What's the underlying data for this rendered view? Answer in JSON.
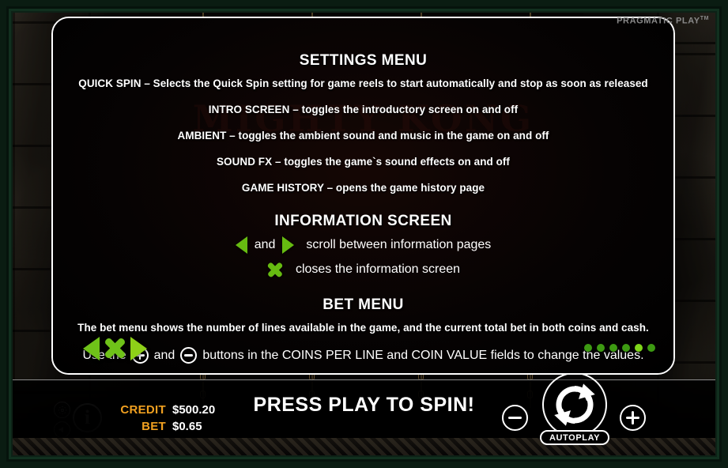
{
  "brand": {
    "name": "PRAGMATIC PLAY",
    "tm": "TM"
  },
  "background": {
    "game_logo": "MIGHTY KONG"
  },
  "panel": {
    "settings": {
      "title": "SETTINGS MENU",
      "lines": [
        "QUICK SPIN – Selects the Quick Spin setting for game reels to start automatically and stop as soon as released",
        "INTRO SCREEN – toggles the introductory screen on and off",
        "AMBIENT – toggles the ambient sound and music in the game on and off",
        "SOUND FX – toggles the game`s sound effects on and off",
        "GAME HISTORY – opens the game history page"
      ]
    },
    "information": {
      "title": "INFORMATION SCREEN",
      "scroll_and": "and",
      "scroll_text": "scroll between information pages",
      "close_text": "closes the information screen"
    },
    "bet": {
      "title": "BET MENU",
      "line1": "The bet menu shows the number of lines available in the game, and the current total bet in both coins and cash.",
      "line2_a": "Use the",
      "line2_and": "and",
      "line2_b": "buttons in the COINS PER LINE and COIN VALUE fields to change the values."
    },
    "nav": {
      "prev": "prev-page-arrow",
      "close": "close-info-screen",
      "next": "next-page-arrow"
    },
    "pagination": {
      "total": 6,
      "active_index": 4
    }
  },
  "hud": {
    "credit_label": "CREDIT",
    "credit_value": "$500.20",
    "bet_label": "BET",
    "bet_value": "$0.65",
    "message": "PRESS PLAY TO SPIN!",
    "autoplay_label": "AUTOPLAY",
    "icons": {
      "gear": "gear-icon",
      "sound": "sound-icon",
      "info": "i",
      "minus": "minus-icon",
      "plus": "plus-icon",
      "spin": "spin-icon"
    }
  },
  "colors": {
    "green_accent": "#6fc219",
    "orange_label": "#f0a020",
    "panel_bg": "#000000",
    "frame": "#0a1c12"
  }
}
